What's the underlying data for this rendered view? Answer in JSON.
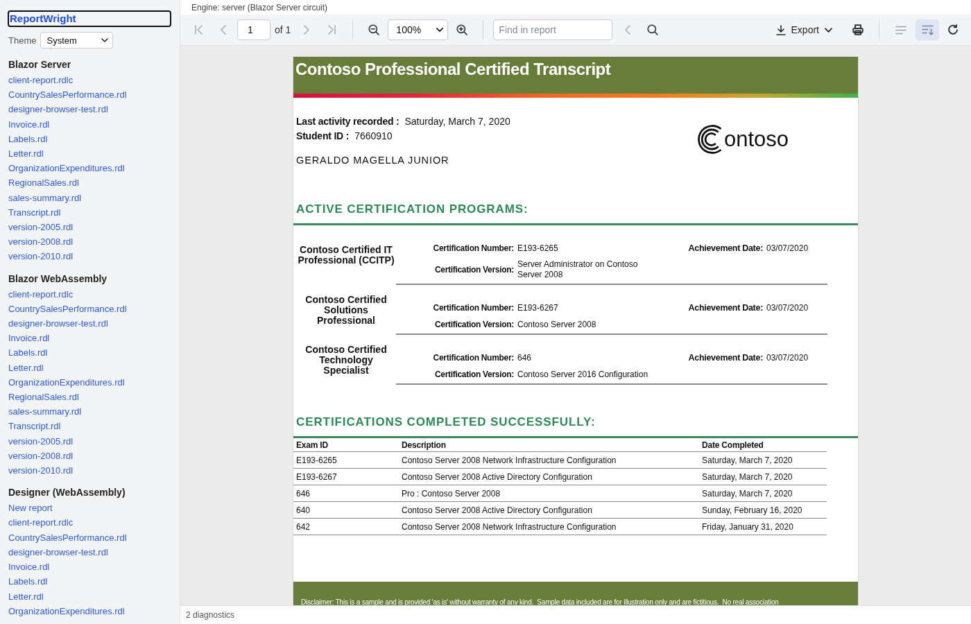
{
  "sidebar": {
    "brand": {
      "text": "ReportWright",
      "focused": true
    },
    "theme": {
      "label": "Theme",
      "value": "System"
    },
    "groups": [
      {
        "title": "Blazor Server",
        "items": [
          "client-report.rdlc",
          "CountrySalesPerformance.rdl",
          "designer-browser-test.rdl",
          "Invoice.rdl",
          "Labels.rdl",
          "Letter.rdl",
          "OrganizationExpenditures.rdl",
          "RegionalSales.rdl",
          "sales-summary.rdl",
          "Transcript.rdl",
          "version-2005.rdl",
          "version-2008.rdl",
          "version-2010.rdl"
        ]
      },
      {
        "title": "Blazor WebAssembly",
        "items": [
          "client-report.rdlc",
          "CountrySalesPerformance.rdl",
          "designer-browser-test.rdl",
          "Invoice.rdl",
          "Labels.rdl",
          "Letter.rdl",
          "OrganizationExpenditures.rdl",
          "RegionalSales.rdl",
          "sales-summary.rdl",
          "Transcript.rdl",
          "version-2005.rdl",
          "version-2008.rdl",
          "version-2010.rdl"
        ]
      },
      {
        "title": "Designer (WebAssembly)",
        "items": [
          "New report",
          "client-report.rdlc",
          "CountrySalesPerformance.rdl",
          "designer-browser-test.rdl",
          "Invoice.rdl",
          "Labels.rdl",
          "Letter.rdl",
          "OrganizationExpenditures.rdl"
        ]
      }
    ]
  },
  "engine_caption": "Engine: server (Blazor Server circuit)",
  "toolbar": {
    "left": [
      {
        "items": [
          {
            "kind": "first-page",
            "disabled": true
          },
          {
            "kind": "previous-page",
            "disabled": true
          },
          {
            "kind": "page-input",
            "value": "1"
          },
          {
            "kind": "page-count",
            "text": "of 1"
          },
          {
            "kind": "next-page",
            "disabled": true
          },
          {
            "kind": "last-page",
            "disabled": true
          }
        ]
      },
      {
        "items": [
          {
            "kind": "zoom-out",
            "disabled": false
          },
          {
            "kind": "zoom-select",
            "value": "100%"
          },
          {
            "kind": "zoom-in",
            "disabled": false
          }
        ]
      },
      {
        "items": [
          {
            "kind": "find-input",
            "placeholder": "Find in report"
          },
          {
            "kind": "previous-match",
            "disabled": true
          },
          {
            "kind": "search",
            "disabled": false
          }
        ]
      }
    ],
    "right": [
      {
        "items": [
          {
            "kind": "export-menu",
            "label": "Export"
          },
          {
            "kind": "print",
            "disabled": false
          }
        ]
      },
      {
        "items": [
          {
            "kind": "page-view",
            "selected": false
          },
          {
            "kind": "flow-view",
            "selected": true
          },
          {
            "kind": "refresh",
            "disabled": false
          }
        ]
      }
    ]
  },
  "report": {
    "title": "Contoso Professional Certified Transcript",
    "fields": [
      {
        "label": "Last activity recorded :",
        "value": "Saturday, March 7, 2020"
      },
      {
        "label": "Student ID :",
        "value": "7660910"
      }
    ],
    "student_name": "GERALDO MAGELLA JUNIOR",
    "logo_text": "ontoso",
    "active_programs": {
      "heading": "ACTIVE CERTIFICATION PROGRAMS:",
      "programs": [
        {
          "name": "Contoso Certified IT Professional (CCITP)",
          "number_label": "Certification Number:",
          "number": "E193-6265",
          "version_label": "Certification Version:",
          "version": "Server Administrator on Contoso Server 2008",
          "date_label": "Achievement Date:",
          "date": "03/07/2020"
        },
        {
          "name": "Contoso Certified Solutions Professional",
          "number_label": "Certification Number:",
          "number": "E193-6267",
          "version_label": "Certification Version:",
          "version": "Contoso Server 2008",
          "date_label": "Achievement Date:",
          "date": "03/07/2020"
        },
        {
          "name": "Contoso Certified Technology Specialist",
          "number_label": "Certification Number:",
          "number": "646",
          "version_label": "Certification Version:",
          "version": "Contoso Server 2016 Configuration",
          "date_label": "Achievement Date:",
          "date": "03/07/2020"
        }
      ]
    },
    "completed": {
      "heading": "CERTIFICATIONS COMPLETED SUCCESSFULLY:",
      "columns": [
        "Exam ID",
        "Description",
        "Date Completed"
      ],
      "rows": [
        [
          "E193-6265",
          "Contoso Server 2008 Network Infrastructure Configuration",
          "Saturday, March 7, 2020"
        ],
        [
          "E193-6267",
          "Contoso Server 2008 Active Directory Configuration",
          "Saturday, March 7, 2020"
        ],
        [
          "646",
          "Pro : Contoso Server 2008",
          "Saturday, March 7, 2020"
        ],
        [
          "640",
          "Contoso Server 2008 Active Directory Configuration",
          "Sunday, February 16, 2020"
        ],
        [
          "642",
          "Contoso Server 2008 Network Infrastructure Configuration",
          "Friday, January 31, 2020"
        ]
      ]
    },
    "disclaimer": "Disclaimer: This is a sample and is provided 'as is' without warranty of any kind.  Sample data included are for illustration only and are fictitious.  No real association"
  },
  "status_bar": {
    "text": "2 diagnostics"
  }
}
